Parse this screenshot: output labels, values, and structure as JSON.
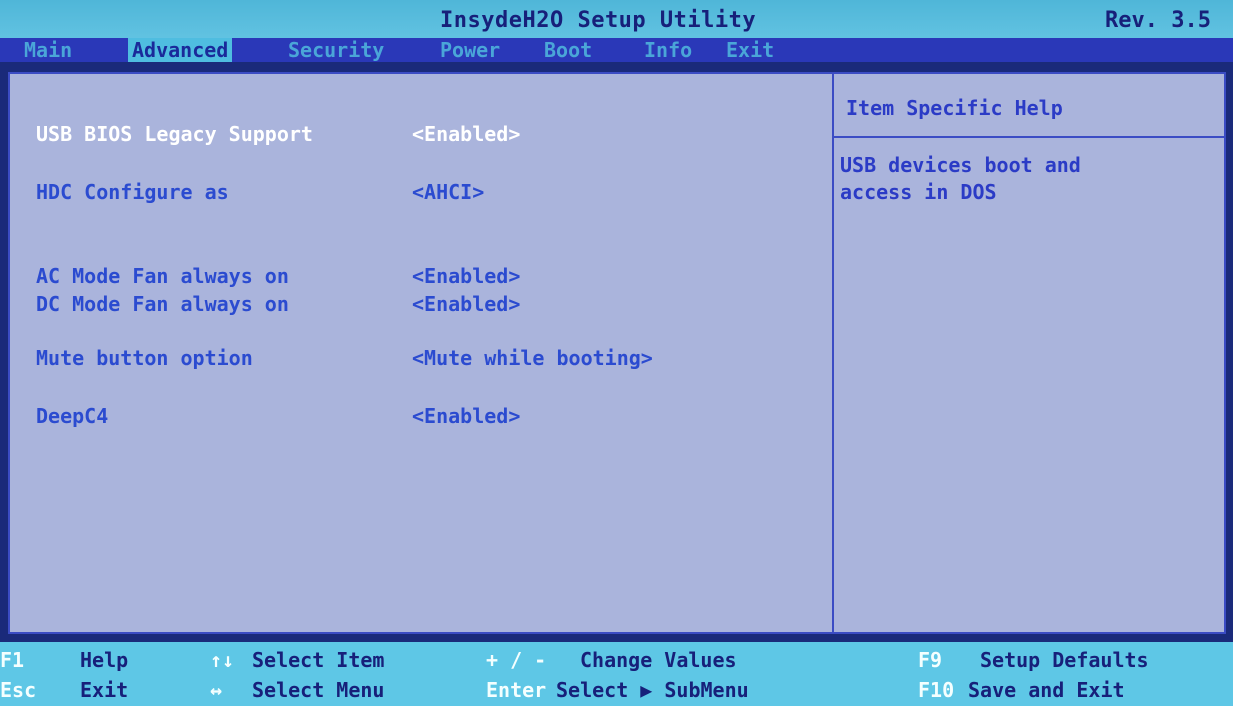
{
  "header": {
    "title": "InsydeH2O Setup Utility",
    "revision": "Rev. 3.5"
  },
  "tabs": [
    {
      "label": "Main"
    },
    {
      "label": "Advanced"
    },
    {
      "label": "Security"
    },
    {
      "label": "Power"
    },
    {
      "label": "Boot"
    },
    {
      "label": "Info"
    },
    {
      "label": "Exit"
    }
  ],
  "active_tab": "Advanced",
  "settings": [
    {
      "label": "USB BIOS Legacy Support",
      "value": "<Enabled>"
    },
    {
      "label": "HDC Configure as",
      "value": "<AHCI>"
    },
    {
      "label": "AC Mode Fan always on",
      "value": "<Enabled>"
    },
    {
      "label": "DC Mode Fan always on",
      "value": "<Enabled>"
    },
    {
      "label": "Mute button option",
      "value": "<Mute while booting>"
    },
    {
      "label": "DeepC4",
      "value": "<Enabled>"
    }
  ],
  "help": {
    "title": "Item Specific Help",
    "lines": [
      "USB devices boot and",
      "access in DOS"
    ]
  },
  "footer": {
    "f1_key": "F1",
    "f1_desc": "Help",
    "esc_key": "Esc",
    "esc_desc": "Exit",
    "updown_key": "↑↓",
    "updown_desc": "Select Item",
    "leftright_key": "↔",
    "leftright_desc": "Select Menu",
    "plusminus_key": "+ / -",
    "plusminus_desc": "Change Values",
    "enter_key": "Enter",
    "enter_desc": "Select ▶ SubMenu",
    "f9_key": "F9",
    "f9_desc": "Setup Defaults",
    "f10_key": "F10",
    "f10_desc": "Save and Exit"
  },
  "colors": {
    "title_bar": "#4fb6d8",
    "menu_bar": "#2a38b8",
    "panel": "#aab4dc",
    "selected_text": "#ffffff",
    "item_text": "#2b4bd0"
  }
}
